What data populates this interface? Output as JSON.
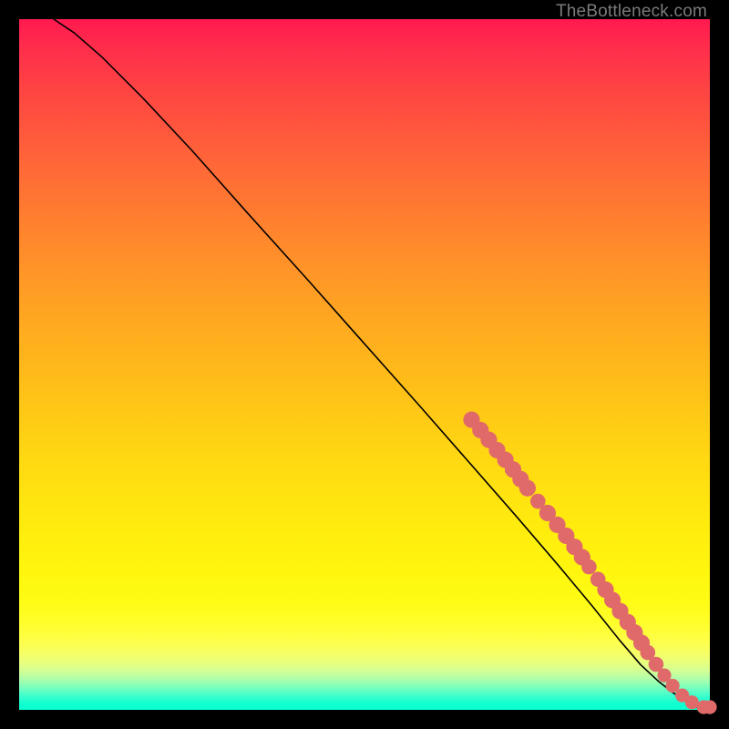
{
  "watermark": "TheBottleneck.com",
  "chart_data": {
    "type": "line",
    "title": "",
    "xlabel": "",
    "ylabel": "",
    "xlim": [
      0,
      100
    ],
    "ylim": [
      0,
      100
    ],
    "curve": {
      "name": "bottleneck-curve",
      "x": [
        5,
        8,
        12,
        18,
        25,
        33,
        42,
        50,
        58,
        65,
        72,
        78,
        83,
        87,
        90,
        92.5,
        94.5,
        96,
        97,
        98,
        100
      ],
      "y": [
        100,
        98,
        94.5,
        88.5,
        81,
        72,
        62,
        53,
        44,
        36,
        28,
        21,
        15,
        10,
        6.5,
        4.2,
        2.6,
        1.6,
        0.9,
        0.4,
        0.4
      ]
    },
    "beads": {
      "name": "highlighted-segment",
      "color": "#e06a6a",
      "points": [
        {
          "x": 65.5,
          "y": 42.0,
          "r": 1.2
        },
        {
          "x": 66.8,
          "y": 40.5,
          "r": 1.2
        },
        {
          "x": 68.0,
          "y": 39.1,
          "r": 1.2
        },
        {
          "x": 69.2,
          "y": 37.6,
          "r": 1.2
        },
        {
          "x": 70.4,
          "y": 36.2,
          "r": 1.2
        },
        {
          "x": 71.5,
          "y": 34.8,
          "r": 1.2
        },
        {
          "x": 72.6,
          "y": 33.4,
          "r": 1.2
        },
        {
          "x": 73.6,
          "y": 32.1,
          "r": 1.2
        },
        {
          "x": 75.1,
          "y": 30.2,
          "r": 1.1
        },
        {
          "x": 76.5,
          "y": 28.5,
          "r": 1.2
        },
        {
          "x": 77.9,
          "y": 26.8,
          "r": 1.2
        },
        {
          "x": 79.2,
          "y": 25.2,
          "r": 1.2
        },
        {
          "x": 80.4,
          "y": 23.6,
          "r": 1.2
        },
        {
          "x": 81.5,
          "y": 22.1,
          "r": 1.2
        },
        {
          "x": 82.5,
          "y": 20.7,
          "r": 1.1
        },
        {
          "x": 83.8,
          "y": 18.9,
          "r": 1.1
        },
        {
          "x": 84.9,
          "y": 17.4,
          "r": 1.2
        },
        {
          "x": 85.9,
          "y": 15.9,
          "r": 1.2
        },
        {
          "x": 87.0,
          "y": 14.3,
          "r": 1.2
        },
        {
          "x": 88.1,
          "y": 12.7,
          "r": 1.2
        },
        {
          "x": 89.1,
          "y": 11.2,
          "r": 1.2
        },
        {
          "x": 90.1,
          "y": 9.7,
          "r": 1.2
        },
        {
          "x": 91.0,
          "y": 8.3,
          "r": 1.1
        },
        {
          "x": 92.2,
          "y": 6.6,
          "r": 1.1
        },
        {
          "x": 93.4,
          "y": 5.0,
          "r": 1.0
        },
        {
          "x": 94.6,
          "y": 3.5,
          "r": 1.0
        },
        {
          "x": 96.0,
          "y": 2.1,
          "r": 1.0
        },
        {
          "x": 97.4,
          "y": 1.1,
          "r": 1.0
        },
        {
          "x": 99.1,
          "y": 0.4,
          "r": 1.0
        },
        {
          "x": 100.0,
          "y": 0.4,
          "r": 1.0
        }
      ]
    }
  }
}
